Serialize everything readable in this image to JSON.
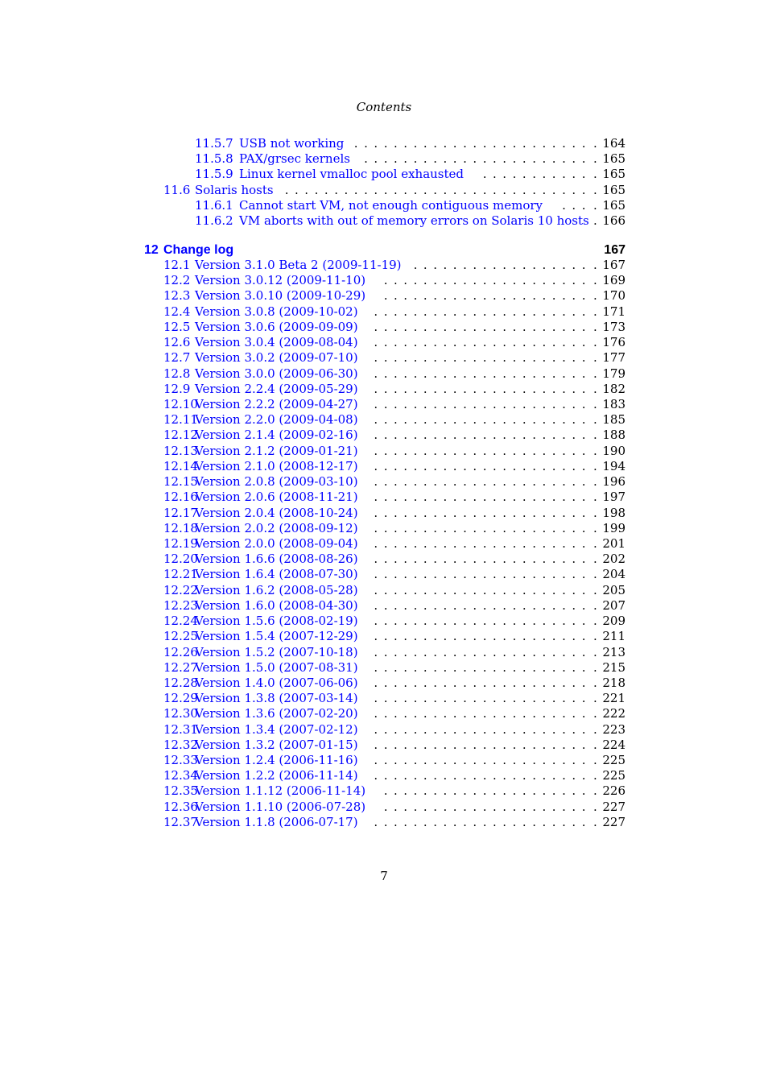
{
  "header": {
    "title": "Contents"
  },
  "entries": [
    {
      "level": 3,
      "number": "11.5.7",
      "title": "USB not working",
      "page": "164"
    },
    {
      "level": 3,
      "number": "11.5.8",
      "title": "PAX/grsec kernels",
      "page": "165"
    },
    {
      "level": 3,
      "number": "11.5.9",
      "title": "Linux kernel vmalloc pool exhausted",
      "page": "165"
    },
    {
      "level": 2,
      "number": "11.6",
      "title": "Solaris hosts",
      "page": "165"
    },
    {
      "level": 3,
      "number": "11.6.1",
      "title": "Cannot start VM, not enough contiguous memory",
      "page": "165"
    },
    {
      "level": 3,
      "number": "11.6.2",
      "title": "VM aborts with out of memory errors on Solaris 10 hosts",
      "page": "166"
    }
  ],
  "chapter": {
    "number": "12",
    "title": "Change log",
    "page": "167"
  },
  "chapter_entries": [
    {
      "number": "12.1",
      "title": "Version 3.1.0 Beta 2 (2009-11-19)",
      "page": "167"
    },
    {
      "number": "12.2",
      "title": "Version 3.0.12 (2009-11-10)",
      "page": "169"
    },
    {
      "number": "12.3",
      "title": "Version 3.0.10 (2009-10-29)",
      "page": "170"
    },
    {
      "number": "12.4",
      "title": "Version 3.0.8 (2009-10-02)",
      "page": "171"
    },
    {
      "number": "12.5",
      "title": "Version 3.0.6 (2009-09-09)",
      "page": "173"
    },
    {
      "number": "12.6",
      "title": "Version 3.0.4 (2009-08-04)",
      "page": "176"
    },
    {
      "number": "12.7",
      "title": "Version 3.0.2 (2009-07-10)",
      "page": "177"
    },
    {
      "number": "12.8",
      "title": "Version 3.0.0 (2009-06-30)",
      "page": "179"
    },
    {
      "number": "12.9",
      "title": "Version 2.2.4 (2009-05-29)",
      "page": "182"
    },
    {
      "number": "12.10",
      "title": "Version 2.2.2 (2009-04-27)",
      "page": "183"
    },
    {
      "number": "12.11",
      "title": "Version 2.2.0 (2009-04-08)",
      "page": "185"
    },
    {
      "number": "12.12",
      "title": "Version 2.1.4 (2009-02-16)",
      "page": "188"
    },
    {
      "number": "12.13",
      "title": "Version 2.1.2 (2009-01-21)",
      "page": "190"
    },
    {
      "number": "12.14",
      "title": "Version 2.1.0 (2008-12-17)",
      "page": "194"
    },
    {
      "number": "12.15",
      "title": "Version 2.0.8 (2009-03-10)",
      "page": "196"
    },
    {
      "number": "12.16",
      "title": "Version 2.0.6 (2008-11-21)",
      "page": "197"
    },
    {
      "number": "12.17",
      "title": "Version 2.0.4 (2008-10-24)",
      "page": "198"
    },
    {
      "number": "12.18",
      "title": "Version 2.0.2 (2008-09-12)",
      "page": "199"
    },
    {
      "number": "12.19",
      "title": "Version 2.0.0 (2008-09-04)",
      "page": "201"
    },
    {
      "number": "12.20",
      "title": "Version 1.6.6 (2008-08-26)",
      "page": "202"
    },
    {
      "number": "12.21",
      "title": "Version 1.6.4 (2008-07-30)",
      "page": "204"
    },
    {
      "number": "12.22",
      "title": "Version 1.6.2 (2008-05-28)",
      "page": "205"
    },
    {
      "number": "12.23",
      "title": "Version 1.6.0 (2008-04-30)",
      "page": "207"
    },
    {
      "number": "12.24",
      "title": "Version 1.5.6 (2008-02-19)",
      "page": "209"
    },
    {
      "number": "12.25",
      "title": "Version 1.5.4 (2007-12-29)",
      "page": "211"
    },
    {
      "number": "12.26",
      "title": "Version 1.5.2 (2007-10-18)",
      "page": "213"
    },
    {
      "number": "12.27",
      "title": "Version 1.5.0 (2007-08-31)",
      "page": "215"
    },
    {
      "number": "12.28",
      "title": "Version 1.4.0 (2007-06-06)",
      "page": "218"
    },
    {
      "number": "12.29",
      "title": "Version 1.3.8 (2007-03-14)",
      "page": "221"
    },
    {
      "number": "12.30",
      "title": "Version 1.3.6 (2007-02-20)",
      "page": "222"
    },
    {
      "number": "12.31",
      "title": "Version 1.3.4 (2007-02-12)",
      "page": "223"
    },
    {
      "number": "12.32",
      "title": "Version 1.3.2 (2007-01-15)",
      "page": "224"
    },
    {
      "number": "12.33",
      "title": "Version 1.2.4 (2006-11-16)",
      "page": "225"
    },
    {
      "number": "12.34",
      "title": "Version 1.2.2 (2006-11-14)",
      "page": "225"
    },
    {
      "number": "12.35",
      "title": "Version 1.1.12 (2006-11-14)",
      "page": "226"
    },
    {
      "number": "12.36",
      "title": "Version 1.1.10 (2006-07-28)",
      "page": "227"
    },
    {
      "number": "12.37",
      "title": "Version 1.1.8 (2006-07-17)",
      "page": "227"
    }
  ],
  "footer": {
    "page_number": "7"
  }
}
